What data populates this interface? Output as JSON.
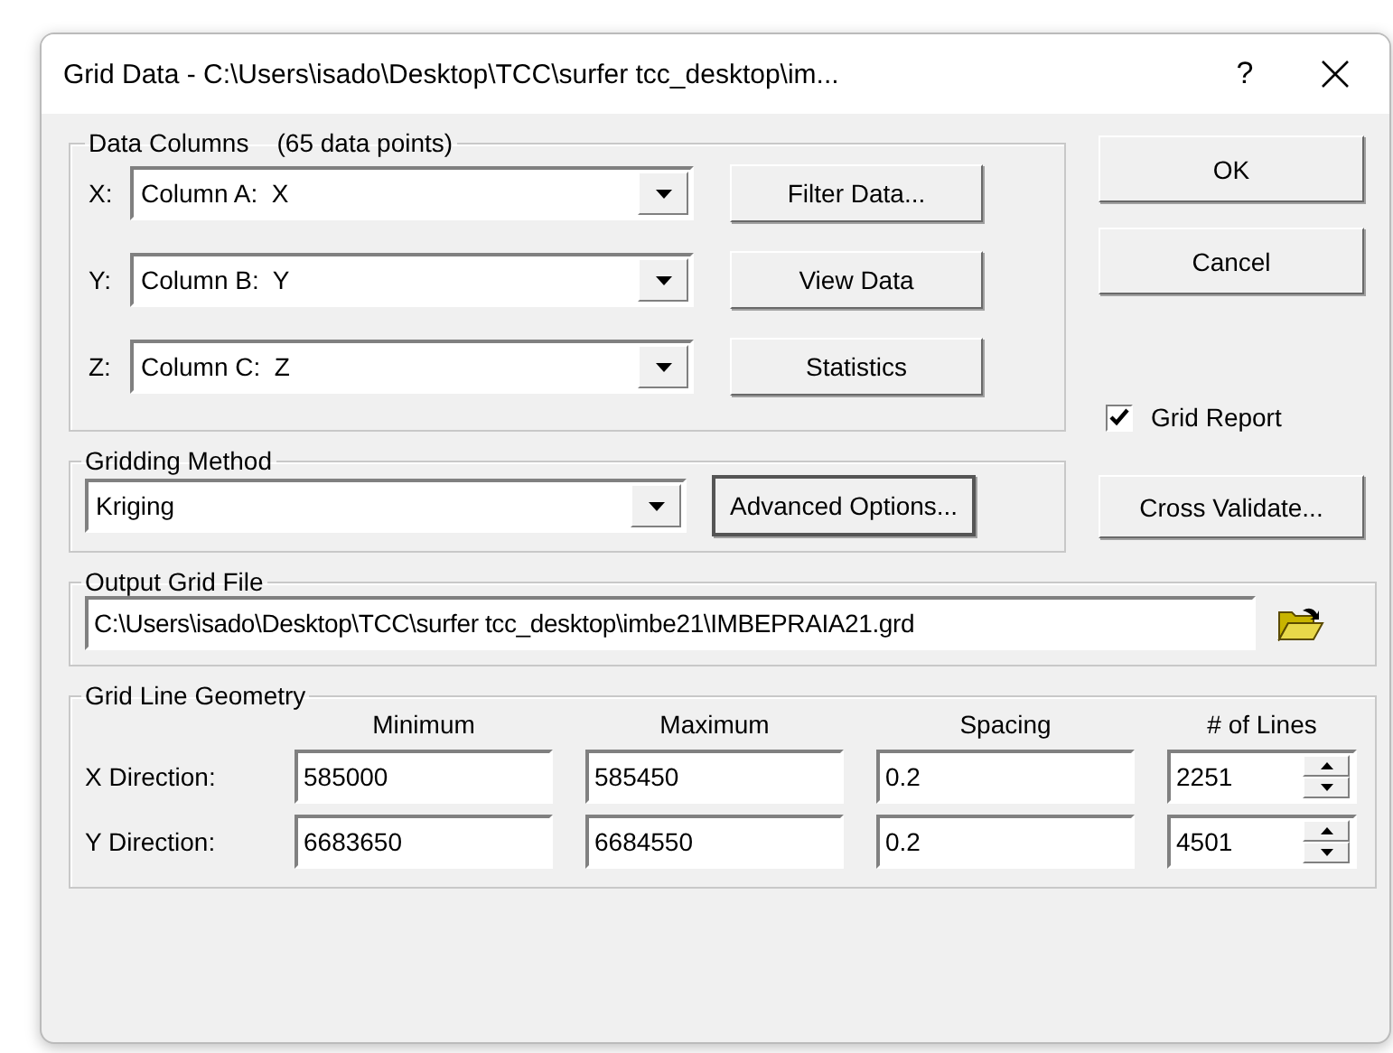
{
  "window": {
    "title": "Grid Data - C:\\Users\\isado\\Desktop\\TCC\\surfer tcc_desktop\\im...",
    "help": "?"
  },
  "data_columns": {
    "title": "Data Columns",
    "count": "(65 data points)",
    "rows": [
      {
        "label": "X:",
        "value": "Column A:  X"
      },
      {
        "label": "Y:",
        "value": "Column B:  Y"
      },
      {
        "label": "Z:",
        "value": "Column C:  Z"
      }
    ],
    "buttons": [
      "Filter Data...",
      "View Data",
      "Statistics"
    ]
  },
  "dialog_buttons": [
    "OK",
    "Cancel"
  ],
  "grid_report": {
    "label": "Grid Report",
    "checked": true
  },
  "gridding_method": {
    "title": "Gridding Method",
    "value": "Kriging",
    "button": "Advanced Options..."
  },
  "cross_validate": "Cross Validate...",
  "output_grid_file": {
    "title": "Output Grid File",
    "value": "C:\\Users\\isado\\Desktop\\TCC\\surfer tcc_desktop\\imbe21\\IMBEPRAIA21.grd"
  },
  "grid_line_geometry": {
    "title": "Grid Line Geometry",
    "columns": [
      "Minimum",
      "Maximum",
      "Spacing",
      "# of Lines"
    ],
    "rows": [
      {
        "label": "X Direction:",
        "minimum": "585000",
        "maximum": "585450",
        "spacing": "0.2",
        "lines": "2251"
      },
      {
        "label": "Y Direction:",
        "minimum": "6683650",
        "maximum": "6684550",
        "spacing": "0.2",
        "lines": "4501"
      }
    ]
  }
}
